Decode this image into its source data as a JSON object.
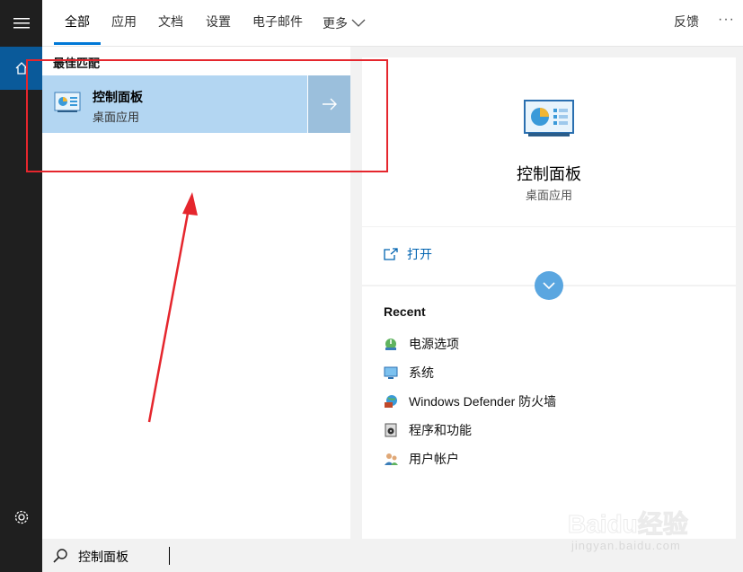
{
  "tabs": [
    "全部",
    "应用",
    "文档",
    "设置",
    "电子邮件"
  ],
  "more_label": "更多",
  "feedback_label": "反馈",
  "ellipsis": "···",
  "best_match": {
    "section_title": "最佳匹配",
    "title": "控制面板",
    "subtitle": "桌面应用"
  },
  "detail": {
    "name": "控制面板",
    "kind": "桌面应用",
    "open_label": "打开",
    "recent_title": "Recent",
    "recent_items": [
      {
        "label": "电源选项",
        "icon": "power-options-icon"
      },
      {
        "label": "系统",
        "icon": "system-icon"
      },
      {
        "label": "Windows Defender 防火墙",
        "icon": "firewall-icon"
      },
      {
        "label": "程序和功能",
        "icon": "programs-icon"
      },
      {
        "label": "用户帐户",
        "icon": "user-accounts-icon"
      }
    ]
  },
  "search": {
    "query": "控制面板"
  },
  "watermark": {
    "main": "Baidu经验",
    "sub": "jingyan.baidu.com"
  },
  "colors": {
    "accent": "#0078d7",
    "selected_bg": "#b3d6f2",
    "rail_bg": "#1f1f1f",
    "annotation": "#e5262d"
  }
}
